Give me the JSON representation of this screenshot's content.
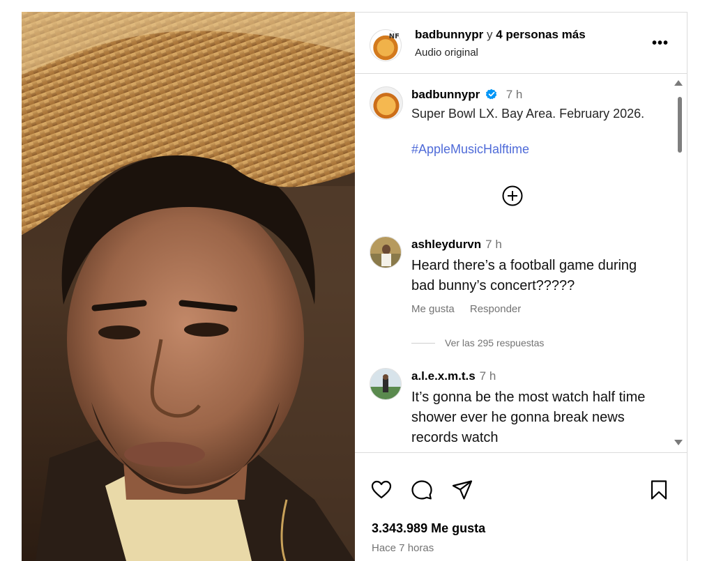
{
  "post": {
    "header": {
      "user": "badbunnypr",
      "joiner": "y",
      "others": "4 personas más",
      "subtitle": "Audio original",
      "more": "•••"
    },
    "caption": {
      "user": "badbunnypr",
      "verified": true,
      "time": "7 h",
      "text": "Super Bowl LX. Bay Area. February 2026.",
      "hashtag": "#AppleMusicHalftime"
    },
    "comments": [
      {
        "user": "ashleydurvn",
        "time": "7 h",
        "text": "Heard there’s a football game during bad bunny’s concert?????",
        "like": "Me gusta",
        "reply": "Responder",
        "replies": "Ver las 295 respuestas"
      },
      {
        "user": "a.l.e.x.m.t.s",
        "time": "7 h",
        "text": "It’s gonna be the most watch half time shower ever he gonna break news records watch"
      }
    ],
    "likes": "3.343.989 Me gusta",
    "time_ago": "Hace 7 horas"
  },
  "colors": {
    "link": "#4f6bd8",
    "verified": "#0095f6",
    "muted": "#737373",
    "border": "#dbdbdb"
  },
  "icons": [
    "heart-icon",
    "comment-icon",
    "share-icon",
    "bookmark-icon",
    "add-circle-icon",
    "verified-icon",
    "more-icon"
  ]
}
